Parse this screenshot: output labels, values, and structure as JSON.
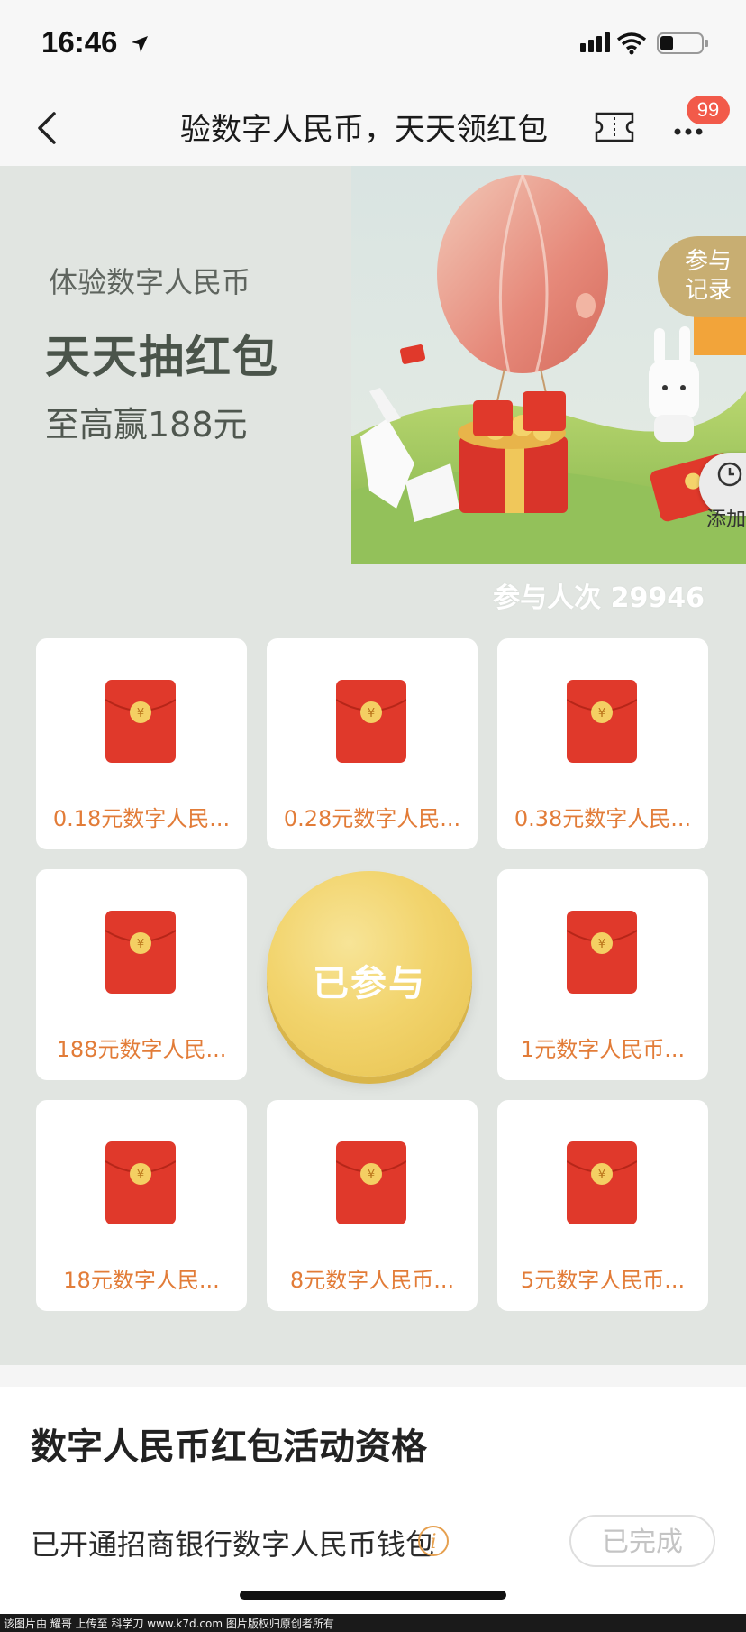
{
  "status_bar": {
    "time": "16:46"
  },
  "nav": {
    "title": "验数字人民币，天天领红包",
    "badge_count": "99"
  },
  "banner": {
    "subtitle": "体验数字人民币",
    "title": "天天抽红包",
    "prize": "至高赢188元",
    "record_label": "参与记录",
    "add_label": "添加"
  },
  "participants": {
    "text": "参与人次 29946"
  },
  "prizes": [
    {
      "label": "0.18元数字人民..."
    },
    {
      "label": "0.28元数字人民..."
    },
    {
      "label": "0.38元数字人民..."
    },
    {
      "label": "188元数字人民..."
    },
    {
      "label": "1元数字人民币..."
    },
    {
      "label": "18元数字人民..."
    },
    {
      "label": "8元数字人民币..."
    },
    {
      "label": "5元数字人民币..."
    }
  ],
  "center_button": {
    "label": "已参与"
  },
  "eligibility": {
    "title": "数字人民币红包活动资格",
    "requirement": "已开通招商银行数字人民币钱包",
    "info_icon": "i",
    "status_label": "已完成"
  },
  "footer": {
    "text": "该图片由 耀哥 上传至 科学刀 www.k7d.com 图片版权归原创者所有"
  },
  "colors": {
    "accent_orange": "#e27c38",
    "envelope_red": "#e0392b",
    "coin_gold": "#f2d46d",
    "page_bg": "#e1e5e1",
    "badge_red": "#f25a4a"
  },
  "icons": [
    "back-arrow",
    "ticket",
    "more-dots",
    "envelope",
    "info",
    "wifi",
    "signal",
    "battery",
    "location-arrow"
  ]
}
